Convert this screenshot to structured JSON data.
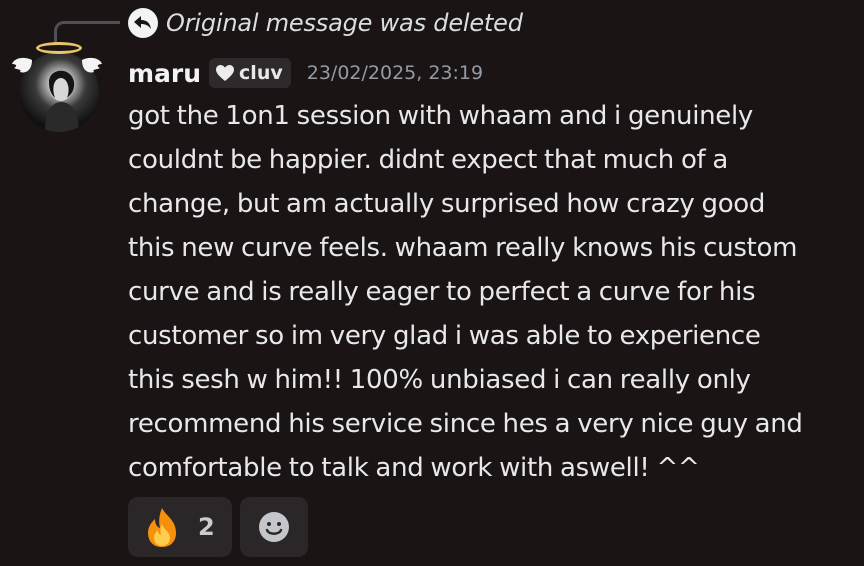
{
  "reply": {
    "text": "Original message was deleted",
    "icon": "reply-arrow-icon"
  },
  "author": {
    "name": "maru",
    "tag_label": "cluv",
    "tag_icon": "heart-icon",
    "avatar_icon": "avatar-with-halo-and-wings"
  },
  "timestamp": "23/02/2025, 23:19",
  "message": {
    "lines": [
      "got the 1on1 session with whaam and i genuinely",
      "couldnt be happier. didnt expect that much of a",
      "change, but am actually surprised how crazy good",
      "this new curve feels. whaam really knows his custom",
      "curve and is really eager to perfect a curve for his",
      "customer so im very glad i was able to experience",
      "this sesh w him!! 100% unbiased i can really only",
      "recommend his service since hes a very nice guy and",
      "comfortable to talk and work with aswell! ^^"
    ]
  },
  "reactions": [
    {
      "emoji": "fire-emoji-icon",
      "count": "2"
    },
    {
      "emoji": "add-reaction-icon"
    }
  ],
  "colors": {
    "background": "#1a1414",
    "text": "#e7e8ea",
    "muted": "#949ba4",
    "reaction_bg": "#2b2729"
  }
}
